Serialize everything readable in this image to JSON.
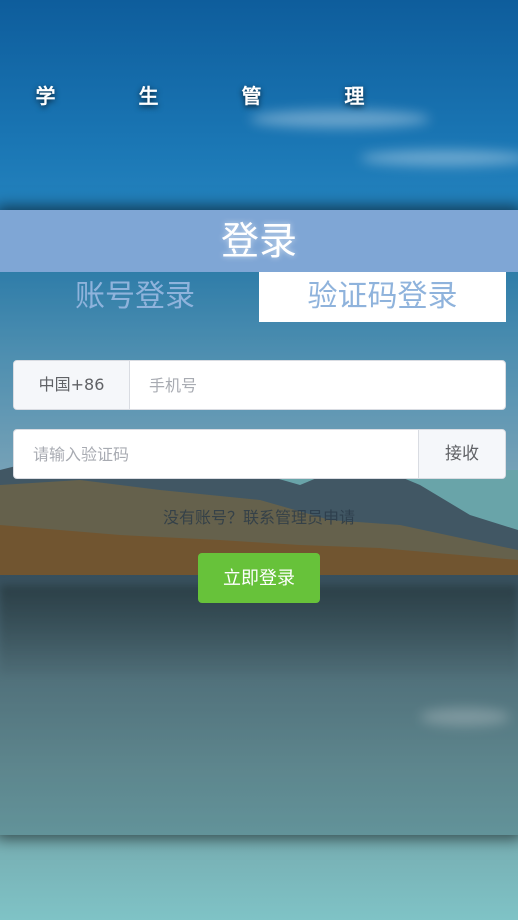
{
  "app": {
    "title": "学 生 管 理"
  },
  "card": {
    "header": "登录",
    "tabs": [
      {
        "label": "账号登录",
        "active": false
      },
      {
        "label": "验证码登录",
        "active": true
      }
    ]
  },
  "form": {
    "country_code": "中国+86",
    "phone": {
      "value": "",
      "placeholder": "手机号"
    },
    "code": {
      "value": "",
      "placeholder": "请输入验证码"
    },
    "receive_label": "接收",
    "hint_text": "没有账号？联系管理员申请",
    "submit_label": "立即登录"
  },
  "colors": {
    "header_bg": "#7fa6d5",
    "tab_text": "#8fb3dc",
    "submit_bg": "#67c23a"
  }
}
